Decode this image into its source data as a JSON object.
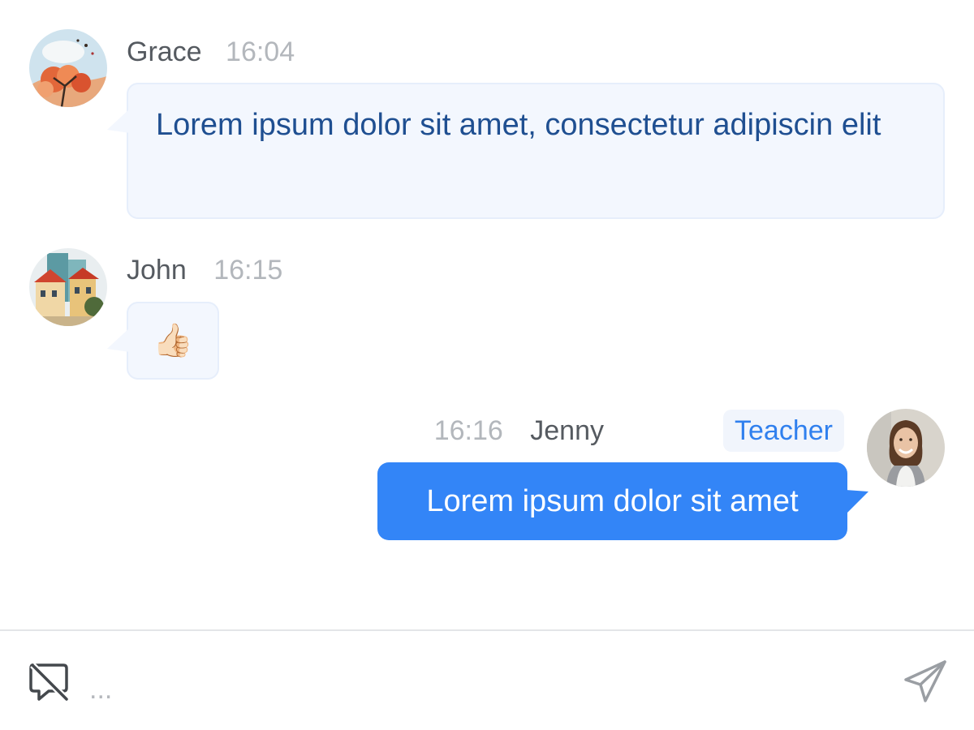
{
  "messages": [
    {
      "sender": "Grace",
      "time": "16:04",
      "text": "Lorem ipsum dolor sit amet, consectetur adipiscin elit",
      "avatar": "autumn-tree-painting-avatar"
    },
    {
      "sender": "John",
      "time": "16:15",
      "text": "👍🏻",
      "avatar": "city-buildings-painting-avatar"
    },
    {
      "sender": "Jenny",
      "time": "16:16",
      "role": "Teacher",
      "text": "Lorem ipsum dolor sit amet",
      "avatar": "smiling-woman-photo-avatar"
    }
  ],
  "input": {
    "placeholder": "...",
    "left_icon": "chat-off-icon",
    "send_icon": "send-icon"
  },
  "colors": {
    "outgoing_bubble": "#3385f7",
    "incoming_bubble": "#f3f7fe",
    "incoming_text": "#1f4f91",
    "role_badge_text": "#3080ee"
  }
}
